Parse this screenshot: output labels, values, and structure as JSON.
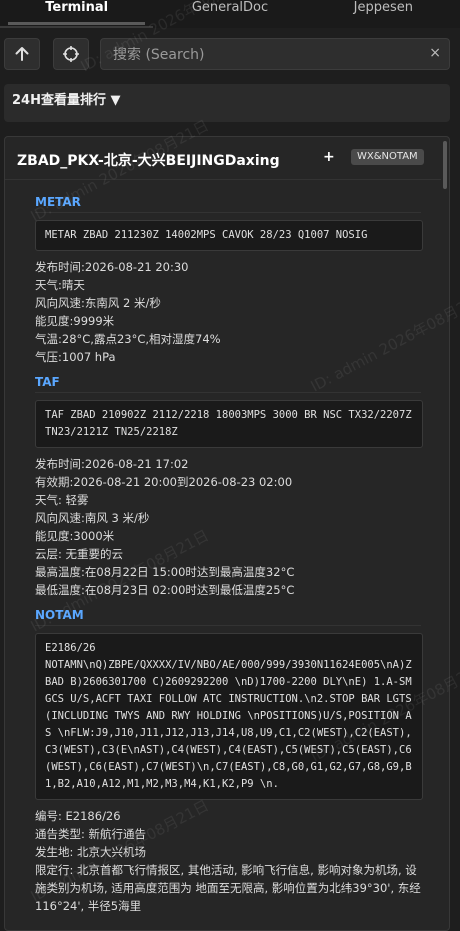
{
  "tabs": [
    "Terminal",
    "GeneralDoc",
    "Jeppesen"
  ],
  "toolbar": {
    "up_icon": "arrow-up-icon",
    "locate_icon": "crosshair-icon"
  },
  "search": {
    "placeholder": "搜索 (Search)",
    "clear": "×"
  },
  "ranking": {
    "label": "24H查看量排行 ▼"
  },
  "airport": {
    "title": "ZBAD_PKX-北京-大兴BEIJINGDaxing",
    "plus": "+",
    "badge": "WX&NOTAM"
  },
  "metar": {
    "title": "METAR",
    "raw": "METAR ZBAD 211230Z 14002MPS CAVOK 28/23 Q1007 NOSIG",
    "info": [
      "发布时间:2026-08-21 20:30",
      "天气:晴天",
      "风向风速:东南风 2 米/秒",
      "能见度:9999米",
      "气温:28°C,露点23°C,相对湿度74%",
      "气压:1007 hPa"
    ]
  },
  "taf": {
    "title": "TAF",
    "raw": "TAF ZBAD 210902Z 2112/2218 18003MPS 3000 BR NSC TX32/2207Z TN23/2121Z TN25/2218Z",
    "info": [
      "发布时间:2026-08-21 17:02",
      "有效期:2026-08-21 20:00到2026-08-23 02:00",
      "天气: 轻雾",
      "风向风速:南风 3 米/秒",
      "能见度:3000米",
      "云层: 无重要的云",
      "最高温度:在08月22日 15:00时达到最高温度32°C",
      "最低温度:在08月23日 02:00时达到最低温度25°C"
    ]
  },
  "notam": {
    "title": "NOTAM",
    "raw": "E2186/26\nNOTAMN\\nQ)ZBPE/QXXXX/IV/NBO/AE/000/999/3930N11624E005\\nA)ZBAD B)2606301700 C)2609292200 \\nD)1700-2200 DLY\\nE) 1.A-SMGCS U/S,ACFT TAXI FOLLOW ATC INSTRUCTION.\\n2.STOP BAR LGTS(INCLUDING TWYS AND RWY HOLDING \\nPOSITIONS)U/S,POSITION AS \\nFLW:J9,J10,J11,J12,J13,J14,U8,U9,C1,C2(WEST),C2(EAST),C3(WEST),C3(E\\nAST),C4(WEST),C4(EAST),C5(WEST),C5(EAST),C6(WEST),C6(EAST),C7(WEST)\\n,C7(EAST),C8,G0,G1,G2,G7,G8,G9,B1,B2,A10,A12,M1,M2,M3,M4,K1,K2,P9 \\n.",
    "info": [
      "编号: E2186/26",
      "通告类型: 新航行通告",
      "发生地: 北京大兴机场",
      "限定行: 北京首都飞行情报区, 其他活动, 影响飞行信息, 影响对象为机场, 设施类别为机场, 适用高度范围为 地面至无限高, 影响位置为北纬39°30', 东经116°24', 半径5海里"
    ]
  },
  "watermark": "ID: admin 2026年08月21日"
}
